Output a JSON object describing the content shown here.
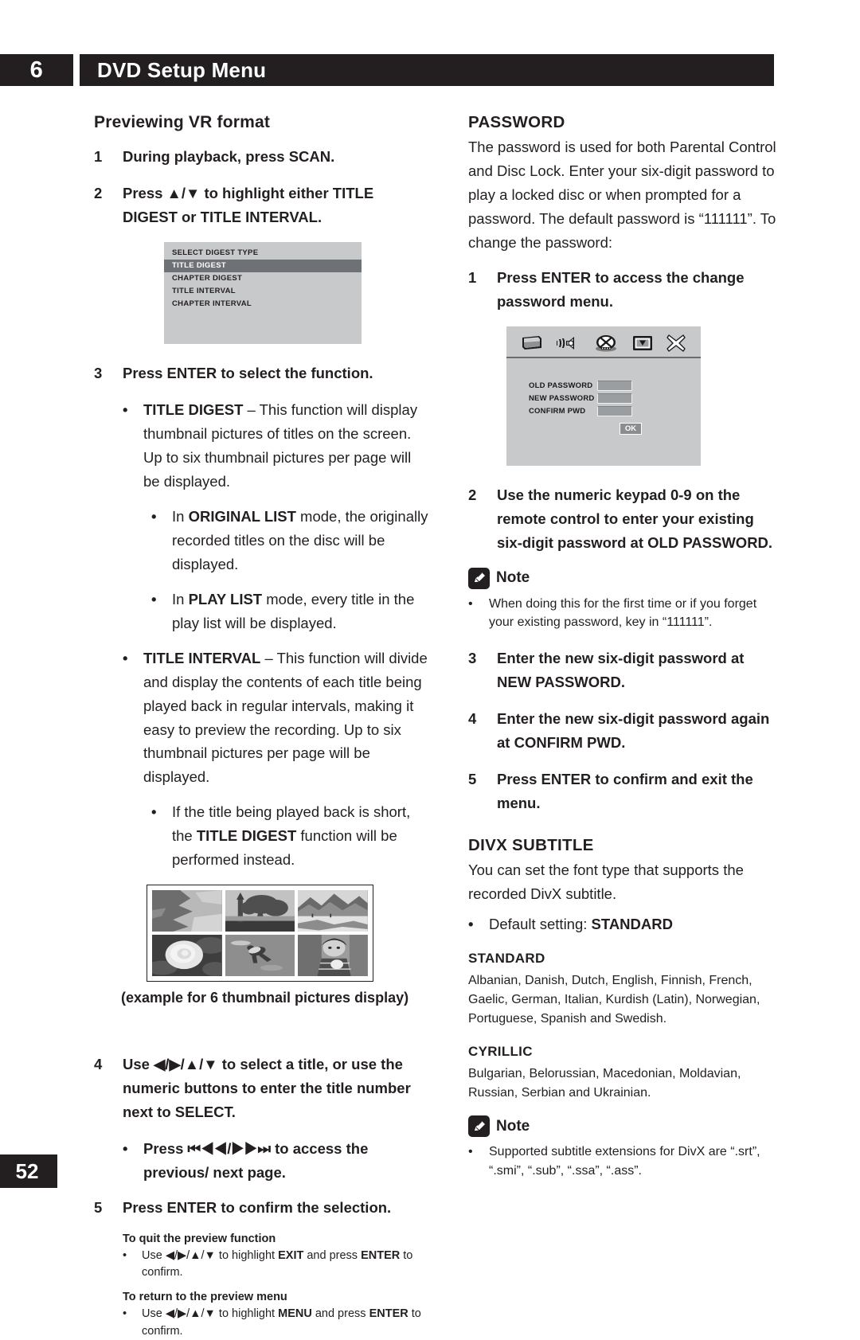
{
  "header": {
    "chapter_number": "6",
    "title": "DVD Setup Menu"
  },
  "page_number": "52",
  "left_column": {
    "subhead": "Previewing VR format",
    "step1": {
      "num": "1",
      "text": "During playback, press SCAN."
    },
    "step2": {
      "num": "2",
      "text": "Press ▲/▼ to highlight either TITLE DIGEST or TITLE INTERVAL."
    },
    "osd_menu": {
      "name": "select-digest-type-menu",
      "rows": [
        {
          "label": "SELECT DIGEST TYPE",
          "selected": false
        },
        {
          "label": "TITLE DIGEST",
          "selected": true
        },
        {
          "label": "CHAPTER DIGEST",
          "selected": false
        },
        {
          "label": "TITLE INTERVAL",
          "selected": false
        },
        {
          "label": "CHAPTER INTERVAL",
          "selected": false
        }
      ]
    },
    "step3": {
      "num": "3",
      "text": "Press ENTER to select the function."
    },
    "bullet_title_digest": {
      "bold": "TITLE DIGEST",
      "text": " – This function will display thumbnail pictures of titles on the screen. Up to six thumbnail pictures per page will be displayed."
    },
    "bullet_original_list": {
      "pre": "In ",
      "bold": "ORIGINAL LIST",
      "text": " mode, the originally recorded titles on the disc will be displayed."
    },
    "bullet_play_list": {
      "pre": "In ",
      "bold": "PLAY LIST",
      "text": " mode, every title in the play list will be displayed."
    },
    "bullet_title_interval": {
      "bold": "TITLE INTERVAL",
      "text": " – This function will divide and display the contents of each title being played back in regular intervals, making it easy to preview the recording. Up to six thumbnail pictures per page will be displayed."
    },
    "bullet_short_title": {
      "pre": "If the title being played back is short, the ",
      "bold": "TITLE DIGEST",
      "text": " function will be performed instead."
    },
    "thumbnail_box": {
      "name": "six-thumbnail-example",
      "thumbnails": [
        "coastline-aerial",
        "tower-and-tree",
        "snowy-mountains",
        "white-rose",
        "person-swimming",
        "child-eating"
      ]
    },
    "thumbnail_caption": "(example for 6 thumbnail pictures display)",
    "step4": {
      "num": "4",
      "text": "Use ◀/▶/▲/▼ to select a title, or use the numeric buttons to enter the title number next to SELECT."
    },
    "bullet_prev_next": {
      "text": "Press ⏮◀◀/▶▶⏭ to access the previous/ next page."
    },
    "step5": {
      "num": "5",
      "text": "Press ENTER to confirm the selection."
    },
    "quit_heading": "To quit the preview function",
    "quit_bullet": {
      "pre": "Use ◀/▶/▲/▼ to highlight ",
      "bold1": "EXIT",
      "mid": " and press ",
      "bold2": "ENTER",
      "post": " to confirm."
    },
    "return_heading": "To return to the preview menu",
    "return_bullet": {
      "pre": "Use ◀/▶/▲/▼ to highlight ",
      "bold1": "MENU",
      "mid": " and press ",
      "bold2": "ENTER",
      "post": " to confirm."
    }
  },
  "right_column": {
    "password_section": {
      "heading": "PASSWORD",
      "intro": "The password is used for both Parental Control and Disc Lock. Enter your six-digit password to play a locked disc or when prompted for a password. The default password is “111111”. To change the password:",
      "step1": {
        "num": "1",
        "text": "Press ENTER to access the change password menu."
      },
      "dialog": {
        "name": "change-password-dialog",
        "icons": [
          "display-icon",
          "audio-speaker-icon",
          "disc-film-icon",
          "preferences-icon",
          "exit-x-icon"
        ],
        "fields": [
          {
            "label": "OLD PASSWORD",
            "value": ""
          },
          {
            "label": "NEW PASSWORD",
            "value": ""
          },
          {
            "label": "CONFIRM PWD",
            "value": ""
          }
        ],
        "ok_label": "OK"
      },
      "step2": {
        "num": "2",
        "text": "Use the numeric keypad 0-9 on the remote control to enter your existing six-digit password at OLD PASSWORD."
      },
      "note1": {
        "title": "Note",
        "icon": "pencil-note-icon",
        "text": "When doing this for the first time or if you forget your existing password, key in “111111”."
      },
      "step3": {
        "num": "3",
        "text": "Enter the new six-digit password at NEW PASSWORD."
      },
      "step4": {
        "num": "4",
        "text": "Enter the new six-digit password again at CONFIRM PWD."
      },
      "step5": {
        "num": "5",
        "text": "Press ENTER to confirm and exit the menu."
      }
    },
    "divx_section": {
      "heading": "DIVX SUBTITLE",
      "intro": "You can set the font type that supports the recorded DivX subtitle.",
      "default_bullet": {
        "pre": "Default setting: ",
        "bold": "STANDARD"
      },
      "standard_heading": "STANDARD",
      "standard_languages": "Albanian, Danish, Dutch, English, Finnish, French, Gaelic, German, Italian, Kurdish (Latin), Norwegian, Portuguese, Spanish and Swedish.",
      "cyrillic_heading": "CYRILLIC",
      "cyrillic_languages": "Bulgarian, Belorussian, Macedonian, Moldavian, Russian, Serbian and Ukrainian.",
      "note2": {
        "title": "Note",
        "icon": "pencil-note-icon",
        "text": "Supported subtitle extensions for DivX are “.srt”, “.smi”, “.sub”, “.ssa”, “.ass”."
      }
    }
  },
  "colors": {
    "ink": "#231f20",
    "osd_bg": "#c8c9ca",
    "osd_highlight": "#6e7276"
  }
}
